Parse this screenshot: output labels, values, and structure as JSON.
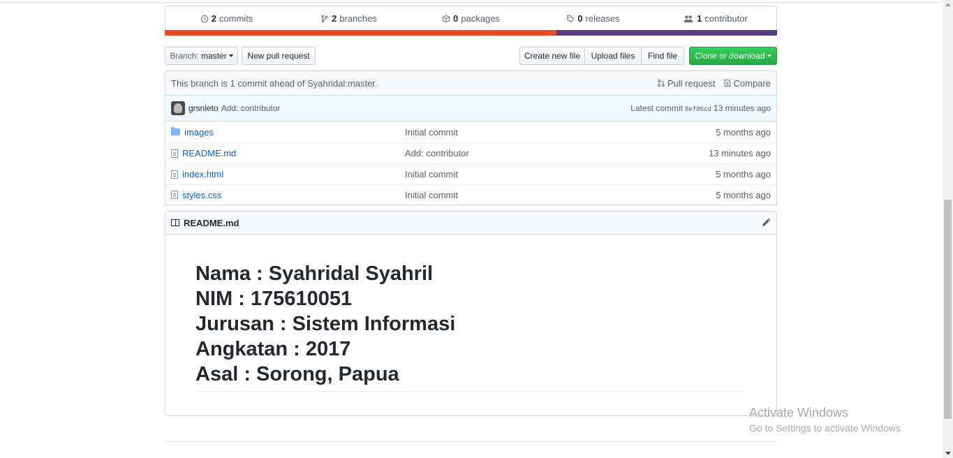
{
  "numbers_summary": [
    {
      "icon": "history-icon",
      "count": "2",
      "label": "commits"
    },
    {
      "icon": "branch-icon",
      "count": "2",
      "label": "branches"
    },
    {
      "icon": "package-icon",
      "count": "0",
      "label": "packages"
    },
    {
      "icon": "tag-icon",
      "count": "0",
      "label": "releases"
    },
    {
      "icon": "people-icon",
      "count": "1",
      "label": "contributor"
    }
  ],
  "language_bar": [
    {
      "color": "#e34c26",
      "fraction": 0.64
    },
    {
      "color": "#563d7c",
      "fraction": 0.36
    }
  ],
  "toolbar": {
    "branch_prefix": "Branch:",
    "branch_name": "master",
    "new_pull_request": "New pull request",
    "create_new_file": "Create new file",
    "upload_files": "Upload files",
    "find_file": "Find file",
    "clone_or_download": "Clone or download"
  },
  "branch_info": {
    "text": "This branch is 1 commit ahead of Syahridal:master.",
    "pull_request": "Pull request",
    "compare": "Compare"
  },
  "latest_commit": {
    "author": "grsnleto",
    "message": "Add: contributor",
    "label": "Latest commit",
    "sha": "8ef86cd",
    "age": "13 minutes ago"
  },
  "files": [
    {
      "type": "dir",
      "name": "images",
      "message": "Initial commit",
      "age": "5 months ago"
    },
    {
      "type": "file",
      "name": "README.md",
      "message": "Add: contributor",
      "age": "13 minutes ago"
    },
    {
      "type": "file",
      "name": "index.html",
      "message": "Initial commit",
      "age": "5 months ago"
    },
    {
      "type": "file",
      "name": "styles.css",
      "message": "Initial commit",
      "age": "5 months ago"
    }
  ],
  "readme": {
    "title": "README.md",
    "lines": [
      "Nama : Syahridal Syahril",
      "NIM : 175610051",
      "Jurusan : Sistem Informasi",
      "Angkatan : 2017",
      "Asal : Sorong, Papua"
    ]
  },
  "watermark": {
    "title": "Activate Windows",
    "subtitle": "Go to Settings to activate Windows."
  },
  "colors": {
    "link": "#0366d6",
    "green_button": "#28a745",
    "commit_bar_bg": "#f1f8ff"
  }
}
